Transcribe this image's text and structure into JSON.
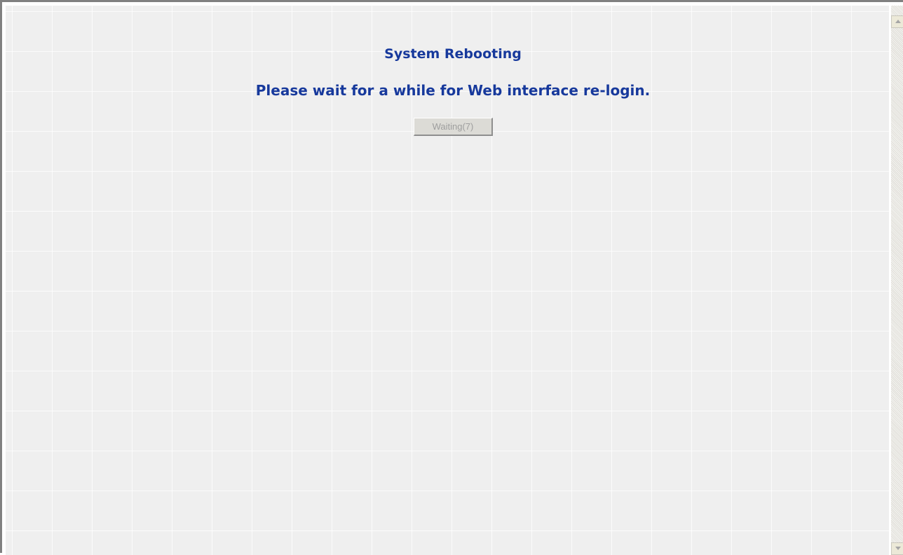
{
  "page": {
    "title": "System Rebooting",
    "message": "Please wait for a while for Web interface re-login.",
    "button_label": "Waiting(7)"
  },
  "colors": {
    "heading": "#17399c",
    "background": "#efefef"
  },
  "scrollbar": {
    "up_icon": "arrow-up-icon",
    "down_icon": "arrow-down-icon"
  }
}
